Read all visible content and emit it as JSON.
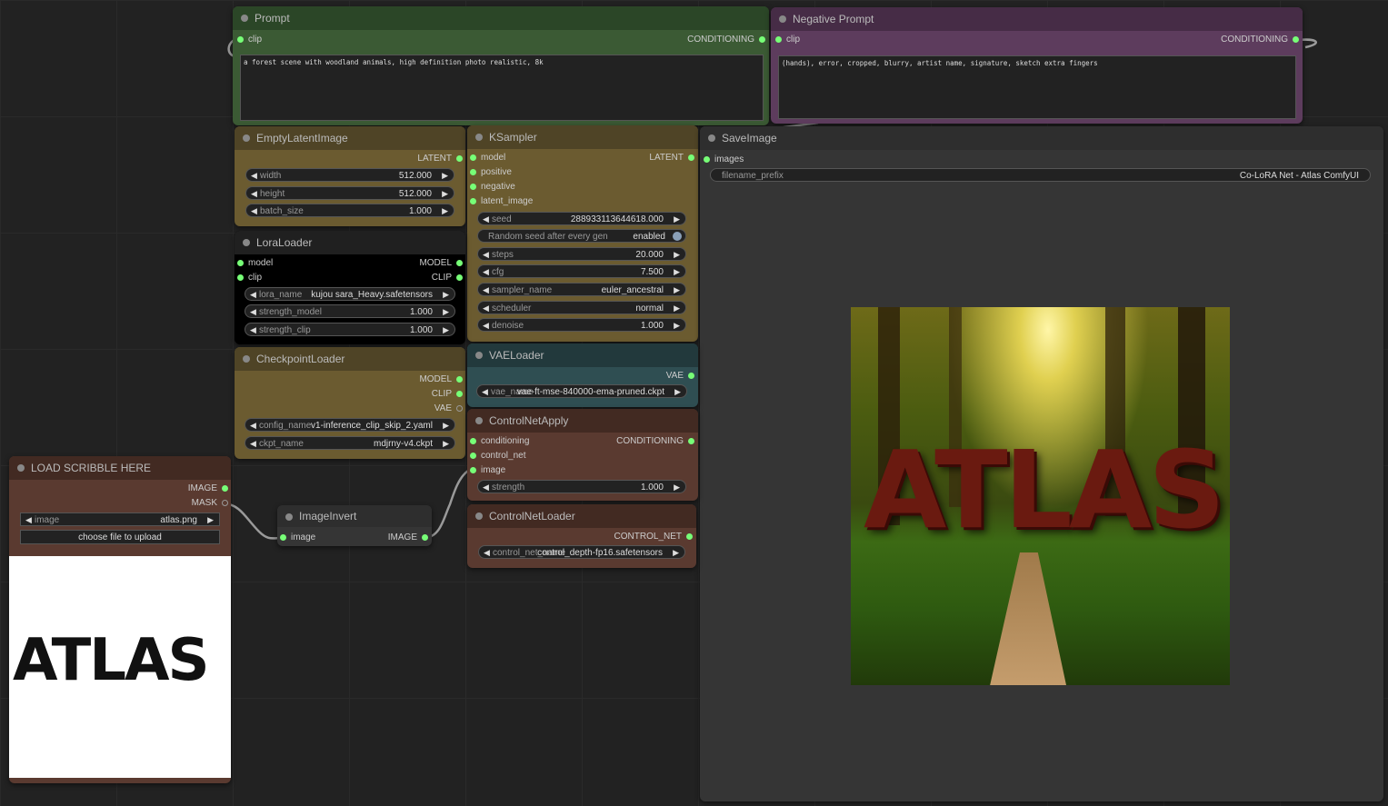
{
  "colors": {
    "link": "#9a9a9a",
    "slot_conditioning": "#7f7",
    "accent_green": "#3a5a3a",
    "accent_purple": "#5a3a5a"
  },
  "prompt": {
    "title": "Prompt",
    "in_clip": "clip",
    "out": "CONDITIONING",
    "text": "a forest scene with woodland animals, high definition photo realistic, 8k"
  },
  "negative": {
    "title": "Negative Prompt",
    "in_clip": "clip",
    "out": "CONDITIONING",
    "text": "(hands), error, cropped, blurry, artist name, signature, sketch extra fingers"
  },
  "empty_latent": {
    "title": "EmptyLatentImage",
    "out": "LATENT",
    "widgets": [
      {
        "label": "width",
        "value": "512.000"
      },
      {
        "label": "height",
        "value": "512.000"
      },
      {
        "label": "batch_size",
        "value": "1.000"
      }
    ]
  },
  "ksampler": {
    "title": "KSampler",
    "out": "LATENT",
    "inputs": [
      "model",
      "positive",
      "negative",
      "latent_image"
    ],
    "seed": {
      "label": "seed",
      "value": "288933113644618.000"
    },
    "random_seed": {
      "label": "Random seed after every gen",
      "value": "enabled"
    },
    "widgets": [
      {
        "label": "steps",
        "value": "20.000"
      },
      {
        "label": "cfg",
        "value": "7.500"
      },
      {
        "label": "sampler_name",
        "value": "euler_ancestral"
      },
      {
        "label": "scheduler",
        "value": "normal"
      },
      {
        "label": "denoise",
        "value": "1.000"
      }
    ]
  },
  "save_image": {
    "title": "SaveImage",
    "in": "images",
    "prefix_label": "filename_prefix",
    "prefix_value": "Co-LoRA Net - Atlas ComfyUI",
    "image_text": "ATLAS"
  },
  "lora": {
    "title": "LoraLoader",
    "inputs": [
      "model",
      "clip"
    ],
    "outputs": [
      "MODEL",
      "CLIP"
    ],
    "widgets": [
      {
        "label": "lora_name",
        "value": "kujou sara_Heavy.safetensors"
      },
      {
        "label": "strength_model",
        "value": "1.000"
      },
      {
        "label": "strength_clip",
        "value": "1.000"
      }
    ]
  },
  "checkpoint": {
    "title": "CheckpointLoader",
    "outputs": [
      "MODEL",
      "CLIP",
      "VAE"
    ],
    "widgets": [
      {
        "label": "config_name",
        "value": "v1-inference_clip_skip_2.yaml"
      },
      {
        "label": "ckpt_name",
        "value": "mdjrny-v4.ckpt"
      }
    ]
  },
  "vae": {
    "title": "VAELoader",
    "out": "VAE",
    "widget": {
      "label": "vae_name",
      "value": "vae-ft-mse-840000-ema-pruned.ckpt"
    }
  },
  "controlnet_apply": {
    "title": "ControlNetApply",
    "out": "CONDITIONING",
    "inputs": [
      "conditioning",
      "control_net",
      "image"
    ],
    "widget": {
      "label": "strength",
      "value": "1.000"
    }
  },
  "controlnet_loader": {
    "title": "ControlNetLoader",
    "out": "CONTROL_NET",
    "widget": {
      "label": "control_net_name",
      "value": "control_depth-fp16.safetensors"
    }
  },
  "load_scribble": {
    "title": "LOAD SCRIBBLE HERE",
    "outputs": [
      "IMAGE",
      "MASK"
    ],
    "widget": {
      "label": "image",
      "value": "atlas.png"
    },
    "button": "choose file to upload",
    "preview_text": "ATLAS"
  },
  "image_invert": {
    "title": "ImageInvert",
    "in": "image",
    "out": "IMAGE"
  }
}
